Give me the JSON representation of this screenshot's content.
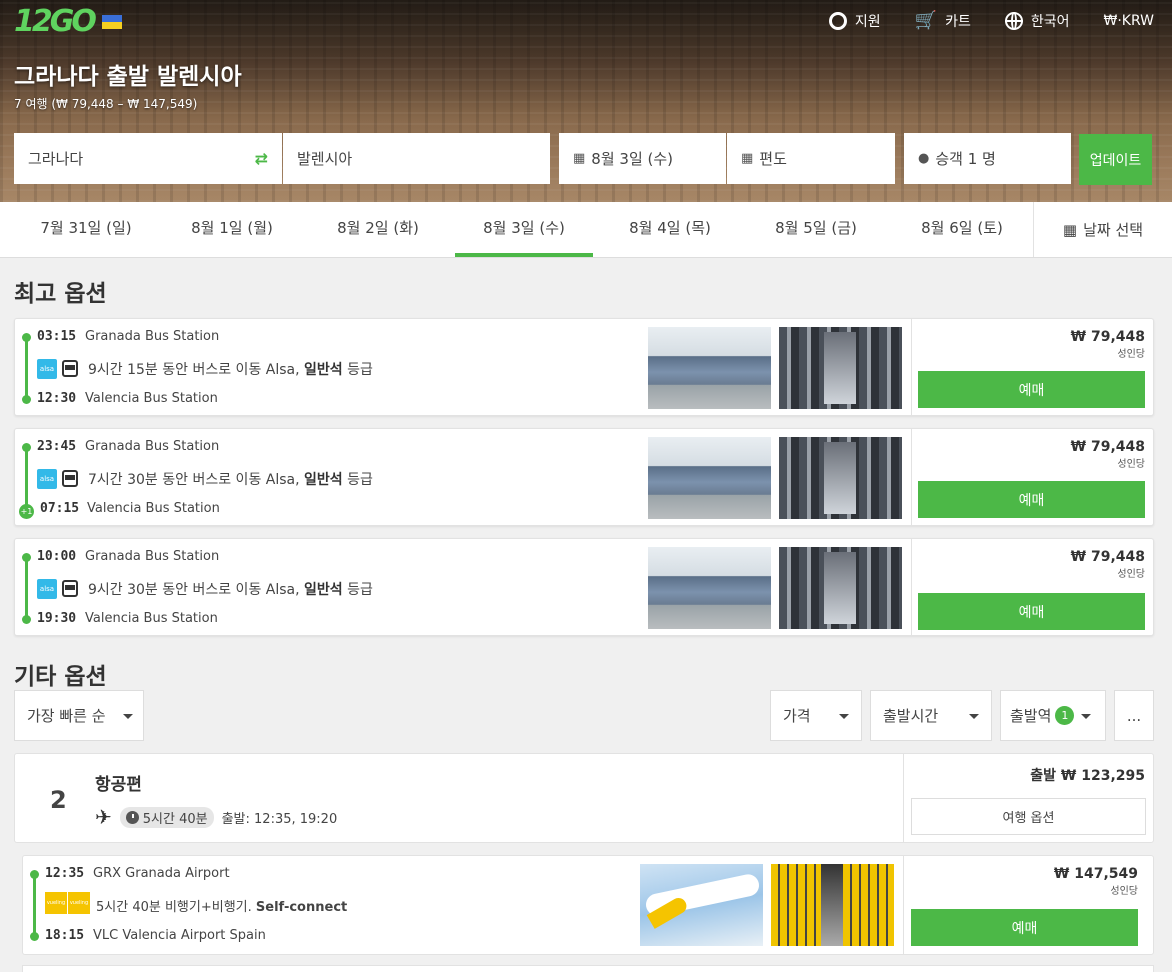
{
  "header": {
    "logo": "12GO",
    "nav": [
      {
        "icon": "lifebuoy-icon",
        "label": "지원"
      },
      {
        "icon": "cart-icon",
        "label": "카트"
      },
      {
        "icon": "globe-icon",
        "label": "한국어"
      },
      {
        "icon": "currency-icon",
        "label": "₩·KRW"
      }
    ],
    "title": "그라나다 출발 발렌시아",
    "subtitle": "7 여행 (₩ 79,448 – ₩ 147,549)"
  },
  "search": {
    "from": "그라나다",
    "to": "발렌시아",
    "date": "8월 3일 (수)",
    "trip": "편도",
    "passengers": "승객 1 명",
    "update": "업데이트"
  },
  "dates": {
    "items": [
      "7월 31일 (일)",
      "8월 1일 (월)",
      "8월 2일 (화)",
      "8월 3일 (수)",
      "8월 4일 (목)",
      "8월 5일 (금)",
      "8월 6일 (토)"
    ],
    "active_index": 3,
    "picker": "날짜 선택"
  },
  "best": {
    "heading": "최고 옵션",
    "trips": [
      {
        "dep": "03:15",
        "from": "Granada Bus Station",
        "desc_pre": "9시간 15분 동안 버스로 이동 Alsa,",
        "cls": "일반석",
        "desc_post": "등급",
        "arr": "12:30",
        "to": "Valencia Bus Station",
        "plus": "",
        "price": "₩ 79,448",
        "per": "성인당",
        "buy": "예매",
        "op": "alsa"
      },
      {
        "dep": "23:45",
        "from": "Granada Bus Station",
        "desc_pre": "7시간 30분 동안 버스로 이동 Alsa,",
        "cls": "일반석",
        "desc_post": "등급",
        "arr": "07:15",
        "to": "Valencia Bus Station",
        "plus": "+1",
        "price": "₩ 79,448",
        "per": "성인당",
        "buy": "예매",
        "op": "alsa"
      },
      {
        "dep": "10:00",
        "from": "Granada Bus Station",
        "desc_pre": "9시간 30분 동안 버스로 이동 Alsa,",
        "cls": "일반석",
        "desc_post": "등급",
        "arr": "19:30",
        "to": "Valencia Bus Station",
        "plus": "",
        "price": "₩ 79,448",
        "per": "성인당",
        "buy": "예매",
        "op": "alsa"
      }
    ]
  },
  "other": {
    "heading": "기타 옵션",
    "sort": "가장 빠른 순",
    "filters": {
      "price": "가격",
      "time": "출발시간",
      "station": "출발역",
      "station_count": "1",
      "more": "..."
    },
    "group": {
      "count": "2",
      "title": "항공편",
      "duration": "5시간 40분",
      "departures": "출발: 12:35, 19:20",
      "price": "출발 ₩ 123,295",
      "options": "여행 옵션"
    },
    "flight": {
      "dep": "12:35",
      "from": "GRX Granada Airport",
      "desc": "5시간 40분 비행기+비행기.",
      "desc_bold": "Self-connect",
      "arr": "18:15",
      "to": "VLC Valencia Airport Spain",
      "price": "₩ 147,549",
      "per": "성인당",
      "buy": "예매",
      "op": "vueling"
    }
  }
}
